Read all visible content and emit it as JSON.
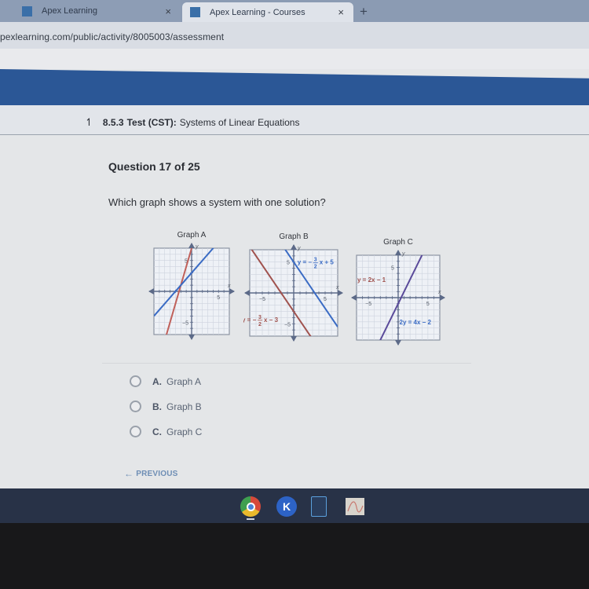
{
  "browser": {
    "tabs": [
      {
        "label": "Apex Learning",
        "active": false
      },
      {
        "label": "Apex Learning - Courses",
        "active": true
      }
    ],
    "close_glyph": "×",
    "new_tab_glyph": "+",
    "url": "pexlearning.com/public/activity/8005003/assessment"
  },
  "header": {
    "up_icon": "↿",
    "course_code": "8.5.3",
    "test_label": "Test (CST):",
    "title": "Systems of Linear Equations"
  },
  "question": {
    "counter": "Question 17 of 25",
    "prompt": "Which graph shows a system with one solution?"
  },
  "graphs": [
    {
      "title": "Graph A",
      "x_label": "x",
      "y_label": "y",
      "tick_labels": {
        "x_pos": "5",
        "y_pos": "5",
        "y_neg": "−5"
      },
      "lines": [
        {
          "color": "#c0605a",
          "slope": 3,
          "intercept": 7
        },
        {
          "color": "#3a6bc4",
          "slope": 1,
          "intercept": 3
        }
      ],
      "equations": []
    },
    {
      "title": "Graph B",
      "x_label": "x",
      "y_label": "y",
      "tick_labels": {
        "x_pos": "5",
        "x_neg": "−5",
        "y_pos": "5",
        "y_neg": "−5"
      },
      "lines": [
        {
          "color": "#3a6bc4",
          "slope": -1.5,
          "intercept": 5
        },
        {
          "color": "#a0524e",
          "slope": -1.5,
          "intercept": -3
        }
      ],
      "equations": [
        {
          "text_pre": "y = −",
          "num": "3",
          "den": "2",
          "text_post": "x + 5",
          "color": "#3a6bc4"
        },
        {
          "text_pre": "y = −",
          "num": "3",
          "den": "2",
          "text_post": "x − 3",
          "color": "#a0524e"
        }
      ]
    },
    {
      "title": "Graph C",
      "x_label": "x",
      "y_label": "y",
      "tick_labels": {
        "x_pos": "5",
        "x_neg": "−5",
        "y_pos": "5"
      },
      "lines": [
        {
          "color": "#5a4a9a",
          "slope": 2,
          "intercept": -1
        }
      ],
      "equations": [
        {
          "text": "y = 2x − 1",
          "color": "#a0524e"
        },
        {
          "text": "2y = 4x − 2",
          "color": "#3a6bc4"
        }
      ]
    }
  ],
  "options": [
    {
      "letter": "A.",
      "label": "Graph A"
    },
    {
      "letter": "B.",
      "label": "Graph B"
    },
    {
      "letter": "C.",
      "label": "Graph C"
    }
  ],
  "nav": {
    "previous_label": "PREVIOUS",
    "previous_arrow": "←"
  },
  "shelf": {
    "apps": [
      "chrome-icon",
      "k-app-icon",
      "document-app-icon",
      "chart-app-icon"
    ],
    "k_letter": "K"
  }
}
